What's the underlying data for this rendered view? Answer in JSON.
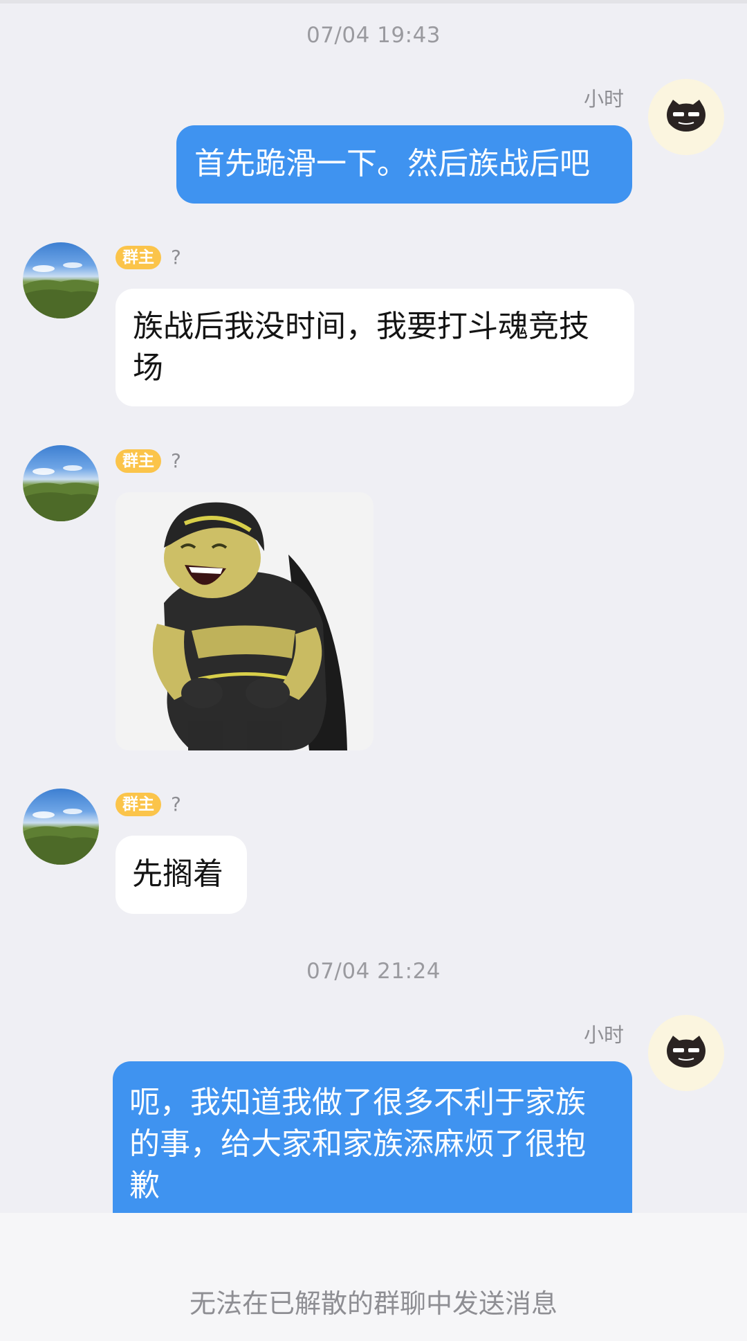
{
  "messages": [
    {
      "timestamp": "07/04 19:43",
      "sender": "小时",
      "text": "首先跪滑一下。然后族战后吧"
    },
    {
      "badge": "群主",
      "name": "?",
      "text": "族战后我没时间，我要打斗魂竞技场"
    },
    {
      "badge": "群主",
      "name": "?",
      "sticker": "laughing-armored-character-sticker"
    },
    {
      "badge": "群主",
      "name": "?",
      "text": "先搁着"
    },
    {
      "timestamp": "07/04 21:24",
      "sender": "小时",
      "text": "呃，我知道我做了很多不利于家族的事，给大家和家族添麻烦了很抱歉"
    }
  ],
  "footer": {
    "notice": "无法在已解散的群聊中发送消息"
  },
  "colors": {
    "background": "#efeff4",
    "outgoing_bubble": "#3f93f0",
    "incoming_bubble": "#ffffff",
    "owner_badge": "#fbc44a",
    "meta_text": "#9a9a9f"
  },
  "icons": {
    "self_avatar": "black-cat-with-glasses-icon",
    "owner_avatar": "green-hill-landscape-icon"
  }
}
